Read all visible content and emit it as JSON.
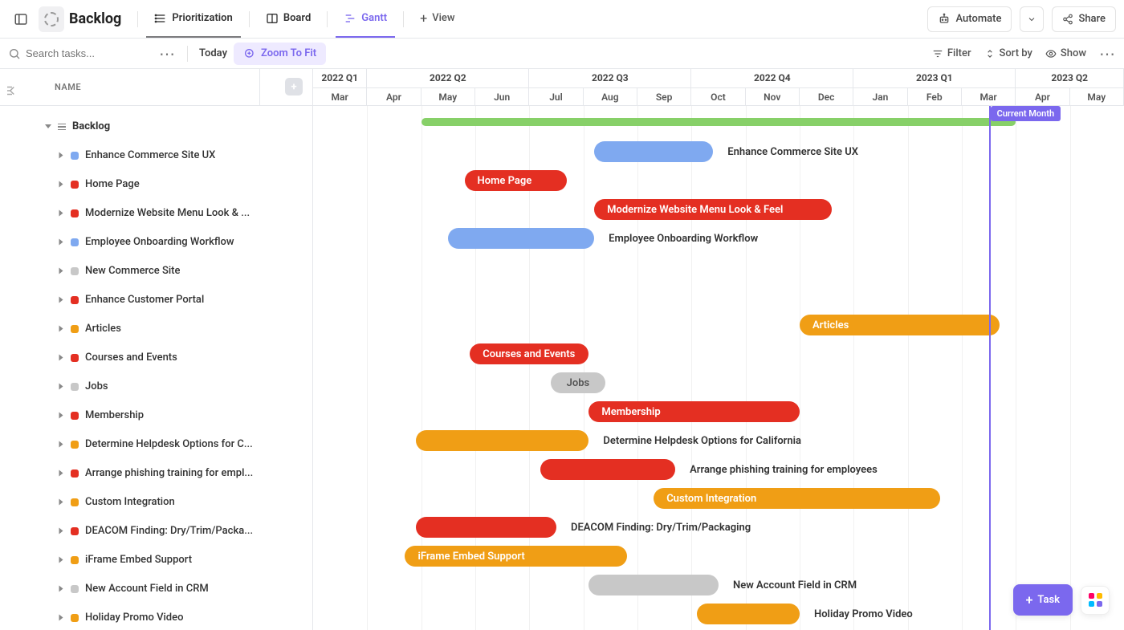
{
  "header": {
    "title": "Backlog",
    "views": [
      {
        "id": "prioritization",
        "label": "Prioritization"
      },
      {
        "id": "board",
        "label": "Board"
      },
      {
        "id": "gantt",
        "label": "Gantt"
      }
    ],
    "add_view_label": "View",
    "automate_label": "Automate",
    "share_label": "Share"
  },
  "toolbar": {
    "search_placeholder": "Search tasks...",
    "today_label": "Today",
    "zoom_label": "Zoom To Fit",
    "filter_label": "Filter",
    "sort_label": "Sort by",
    "show_label": "Show"
  },
  "sidebar": {
    "name_col_label": "NAME",
    "group_label": "Backlog",
    "items": [
      {
        "label": "Enhance Commerce Site UX",
        "color": "blue"
      },
      {
        "label": "Home Page",
        "color": "red"
      },
      {
        "label": "Modernize Website Menu Look & ...",
        "color": "red"
      },
      {
        "label": "Employee Onboarding Workflow",
        "color": "blue"
      },
      {
        "label": "New Commerce Site",
        "color": "gray"
      },
      {
        "label": "Enhance Customer Portal",
        "color": "red"
      },
      {
        "label": "Articles",
        "color": "orange"
      },
      {
        "label": "Courses and Events",
        "color": "red"
      },
      {
        "label": "Jobs",
        "color": "gray"
      },
      {
        "label": "Membership",
        "color": "red"
      },
      {
        "label": "Determine Helpdesk Options for C...",
        "color": "orange"
      },
      {
        "label": "Arrange phishing training for empl...",
        "color": "red"
      },
      {
        "label": "Custom Integration",
        "color": "orange"
      },
      {
        "label": "DEACOM Finding: Dry/Trim/Packa...",
        "color": "red"
      },
      {
        "label": "iFrame Embed Support",
        "color": "orange"
      },
      {
        "label": "New Account Field in CRM",
        "color": "gray"
      },
      {
        "label": "Holiday Promo Video",
        "color": "orange"
      }
    ]
  },
  "timeline": {
    "quarters": [
      {
        "label": "2022 Q1",
        "span": 1
      },
      {
        "label": "2022 Q2",
        "span": 3
      },
      {
        "label": "2022 Q3",
        "span": 3
      },
      {
        "label": "2022 Q4",
        "span": 3
      },
      {
        "label": "2023 Q1",
        "span": 3
      },
      {
        "label": "2023 Q2",
        "span": 2
      }
    ],
    "months": [
      "Mar",
      "Apr",
      "May",
      "Jun",
      "Jul",
      "Aug",
      "Sep",
      "Oct",
      "Nov",
      "Dec",
      "Jan",
      "Feb",
      "Mar",
      "Apr",
      "May"
    ],
    "current_month_label": "Current Month",
    "current_month_index": 13
  },
  "bars": {
    "group": {
      "start": 2.0,
      "end": 13.0
    },
    "list": [
      {
        "text": "Enhance Commerce Site UX",
        "color": "blue",
        "start": 5.2,
        "end": 7.4,
        "labelOutside": true
      },
      {
        "text": "Home Page",
        "color": "red",
        "start": 2.8,
        "end": 4.7,
        "labelOutside": false
      },
      {
        "text": "Modernize Website Menu Look & Feel",
        "color": "red",
        "start": 5.2,
        "end": 9.6,
        "labelOutside": false
      },
      {
        "text": "Employee Onboarding Workflow",
        "color": "blue",
        "start": 2.5,
        "end": 5.2,
        "labelOutside": true
      },
      {
        "text": "",
        "color": "",
        "start": 0,
        "end": 0,
        "labelOutside": true,
        "hidden": true
      },
      {
        "text": "",
        "color": "",
        "start": 0,
        "end": 0,
        "labelOutside": true,
        "hidden": true
      },
      {
        "text": "Articles",
        "color": "orange",
        "start": 9.0,
        "end": 12.7,
        "labelOutside": false
      },
      {
        "text": "Courses and Events",
        "color": "red",
        "start": 2.9,
        "end": 5.1,
        "labelOutside": false
      },
      {
        "text": "Jobs",
        "color": "gray",
        "start": 4.4,
        "end": 5.4,
        "labelOutside": false,
        "center": true
      },
      {
        "text": "Membership",
        "color": "red",
        "start": 5.1,
        "end": 9.0,
        "labelOutside": false
      },
      {
        "text": "Determine Helpdesk Options for California",
        "color": "orange",
        "start": 1.9,
        "end": 5.1,
        "labelOutside": true
      },
      {
        "text": "Arrange phishing training for employees",
        "color": "red",
        "start": 4.2,
        "end": 6.7,
        "labelOutside": true
      },
      {
        "text": "Custom Integration",
        "color": "orange",
        "start": 6.3,
        "end": 11.6,
        "labelOutside": false
      },
      {
        "text": "DEACOM Finding: Dry/Trim/Packaging",
        "color": "red",
        "start": 1.9,
        "end": 4.5,
        "labelOutside": true
      },
      {
        "text": "iFrame Embed Support",
        "color": "orange",
        "start": 1.7,
        "end": 5.8,
        "labelOutside": false
      },
      {
        "text": "New Account Field in CRM",
        "color": "gray",
        "start": 5.1,
        "end": 7.5,
        "labelOutside": true
      },
      {
        "text": "Holiday Promo Video",
        "color": "orange",
        "start": 7.1,
        "end": 9.0,
        "labelOutside": true
      }
    ]
  },
  "fab": {
    "task_label": "Task"
  }
}
